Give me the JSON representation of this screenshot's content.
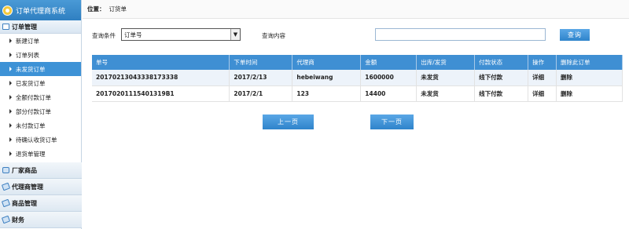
{
  "app": {
    "title": "订单代理商系统"
  },
  "sidebar": {
    "group_order": "订单管理",
    "items": [
      {
        "label": "新建订单"
      },
      {
        "label": "订单列表"
      },
      {
        "label": "未发货订单"
      },
      {
        "label": "已发货订单"
      },
      {
        "label": "全额付款订单"
      },
      {
        "label": "部分付款订单"
      },
      {
        "label": "未付款订单"
      },
      {
        "label": "待确认收货订单"
      },
      {
        "label": "退货单管理"
      }
    ],
    "groups": [
      {
        "label": "厂家商品"
      },
      {
        "label": "代理商管理"
      },
      {
        "label": "商品管理"
      },
      {
        "label": "财务"
      }
    ]
  },
  "location": {
    "label": "位置：",
    "value": "订货单"
  },
  "query": {
    "condition_label": "查询条件",
    "condition_value": "订单号",
    "content_label": "查询内容",
    "content_value": "",
    "search_button": "查询"
  },
  "table": {
    "headers": [
      "单号",
      "下单时间",
      "代理商",
      "金额",
      "出库/发货",
      "付款状态",
      "操作",
      "删除此订单"
    ],
    "rows": [
      [
        "20170213043338173338",
        "2017/2/13",
        "hebeiwang",
        "1600000",
        "未发货",
        "线下付款",
        "详细",
        "删除"
      ],
      [
        "20170201115401319B1",
        "2017/2/1",
        "123",
        "14400",
        "未发货",
        "线下付款",
        "详细",
        "删除"
      ]
    ]
  },
  "pager": {
    "prev": "上一页",
    "next": "下一页"
  }
}
